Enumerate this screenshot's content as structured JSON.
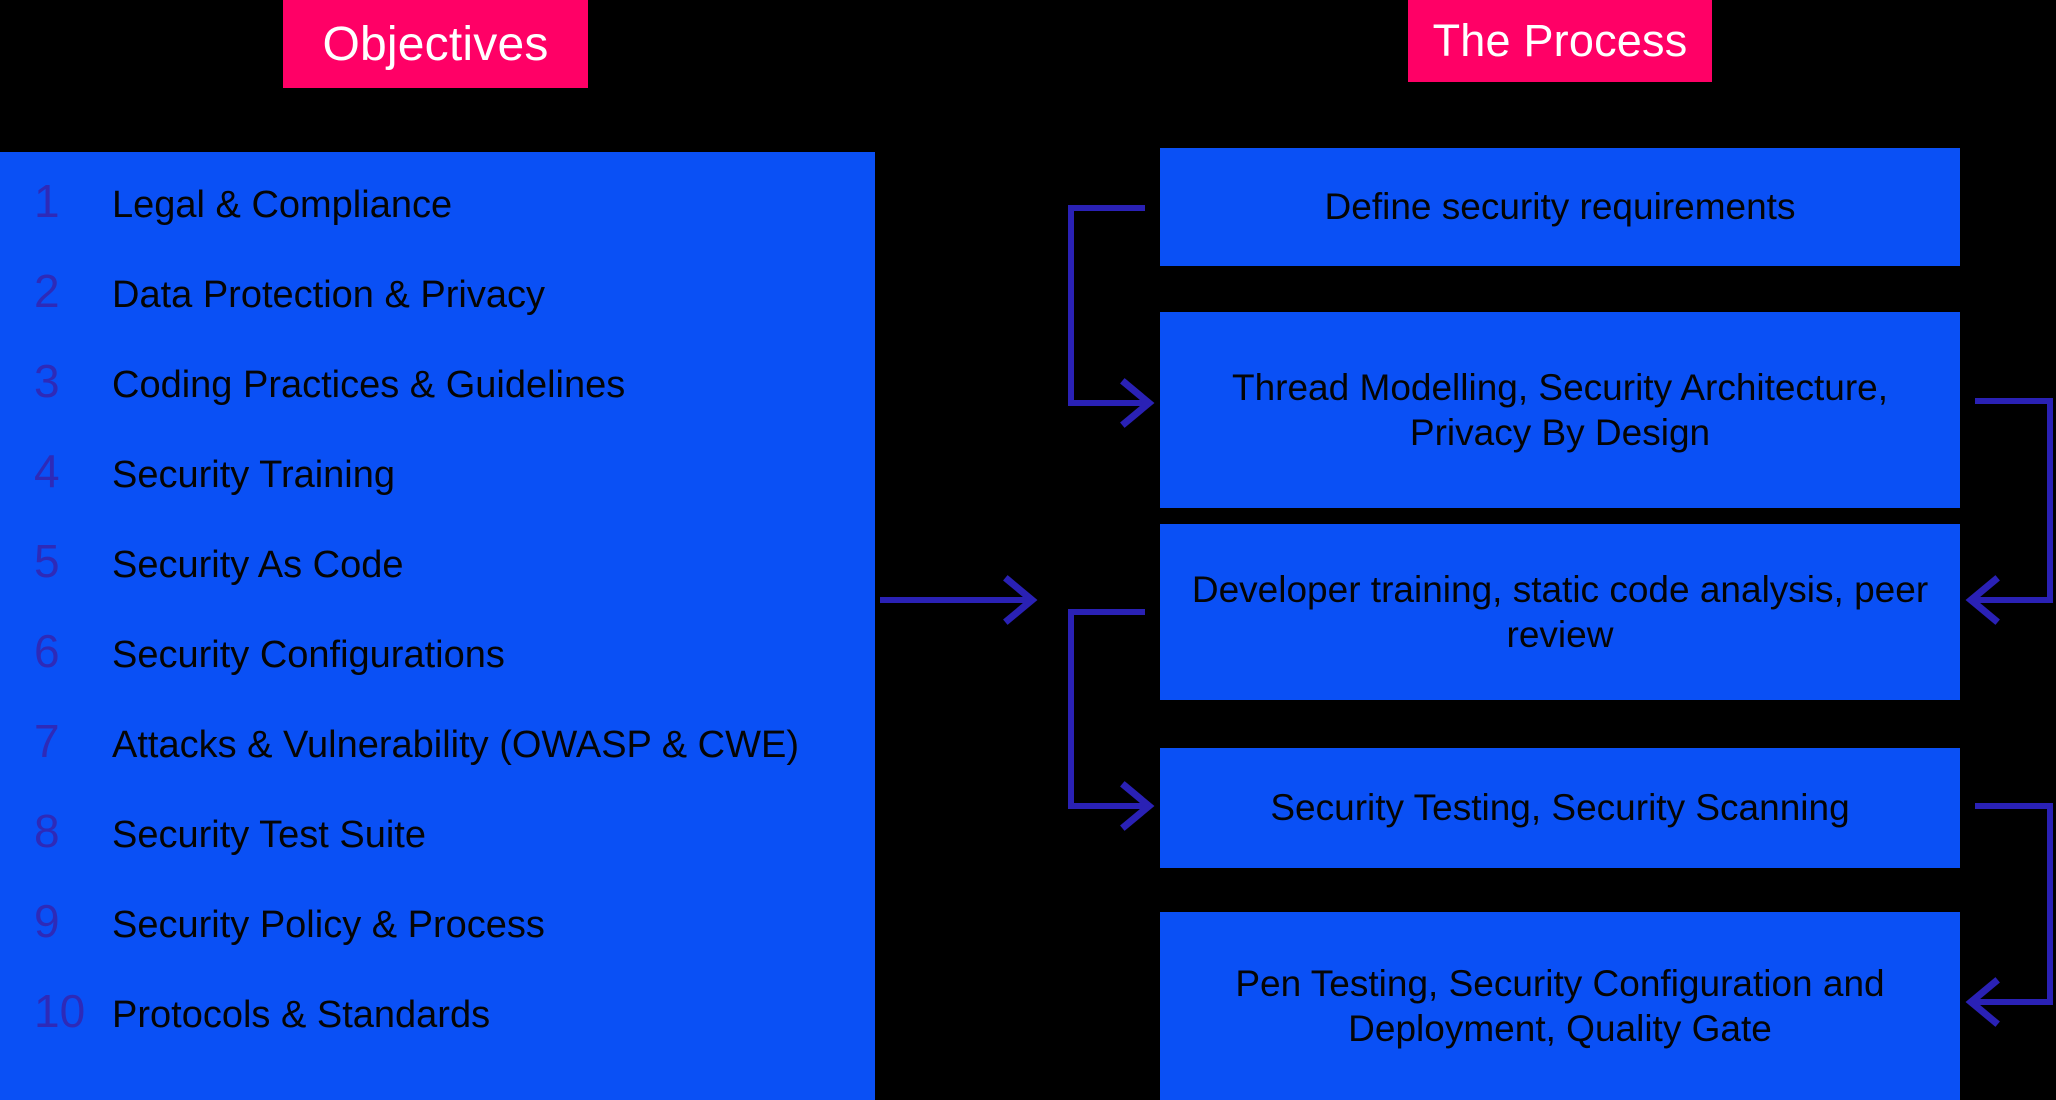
{
  "headers": {
    "objectives": "Objectives",
    "process": "The Process"
  },
  "colors": {
    "background": "#000000",
    "panel_blue": "#0A50F5",
    "badge_pink": "#FF0066",
    "number_indigo": "#2E2AB8",
    "connector_indigo": "#2A21B5",
    "text_black": "#050505",
    "badge_text": "#FFFFFF"
  },
  "objectives": {
    "items": [
      {
        "num": "1",
        "label": "Legal & Compliance"
      },
      {
        "num": "2",
        "label": "Data Protection & Privacy"
      },
      {
        "num": "3",
        "label": "Coding Practices & Guidelines"
      },
      {
        "num": "4",
        "label": "Security Training"
      },
      {
        "num": "5",
        "label": "Security As Code"
      },
      {
        "num": "6",
        "label": "Security Configurations"
      },
      {
        "num": "7",
        "label": "Attacks & Vulnerability (OWASP & CWE)"
      },
      {
        "num": "8",
        "label": "Security Test Suite"
      },
      {
        "num": "9",
        "label": "Security Policy & Process"
      },
      {
        "num": "10",
        "label": "Protocols & Standards"
      }
    ]
  },
  "process": {
    "steps": [
      {
        "label": "Define security requirements"
      },
      {
        "label": "Thread Modelling, Security Architecture, Privacy By Design"
      },
      {
        "label": "Developer training, static code analysis, peer review"
      },
      {
        "label": "Security Testing, Security Scanning"
      },
      {
        "label": "Pen Testing, Security Configuration and Deployment, Quality Gate"
      }
    ]
  }
}
